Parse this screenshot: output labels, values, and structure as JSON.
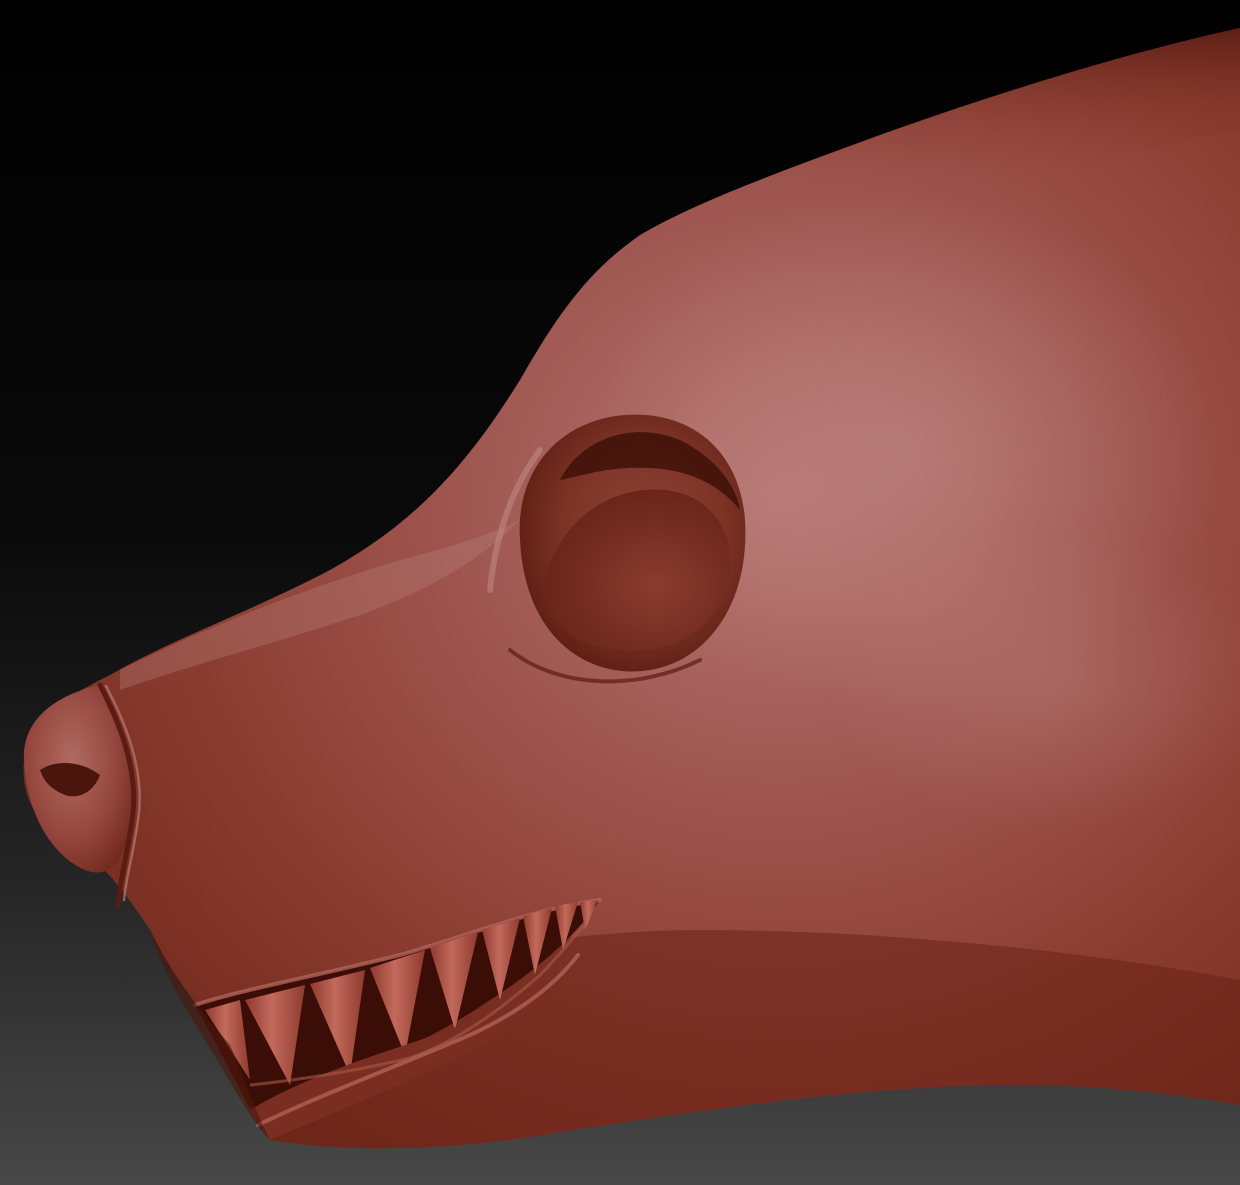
{
  "scene": {
    "subject": "sculpted-creature-head",
    "view": "side-profile-facing-left",
    "material": "clay-red-matcap"
  },
  "colors": {
    "background_top": "#000000",
    "background_mid": "#1e1e1e",
    "background_bottom": "#474747",
    "clay_light": "#b97a78",
    "clay_mid": "#9a4b42",
    "clay_base": "#8a3b2e",
    "clay_dark": "#6b2418",
    "clay_shadow": "#4a150c",
    "mouth_interior": "#3a0d06",
    "teeth": "#a84536",
    "teeth_highlight": "#c46a5c"
  }
}
